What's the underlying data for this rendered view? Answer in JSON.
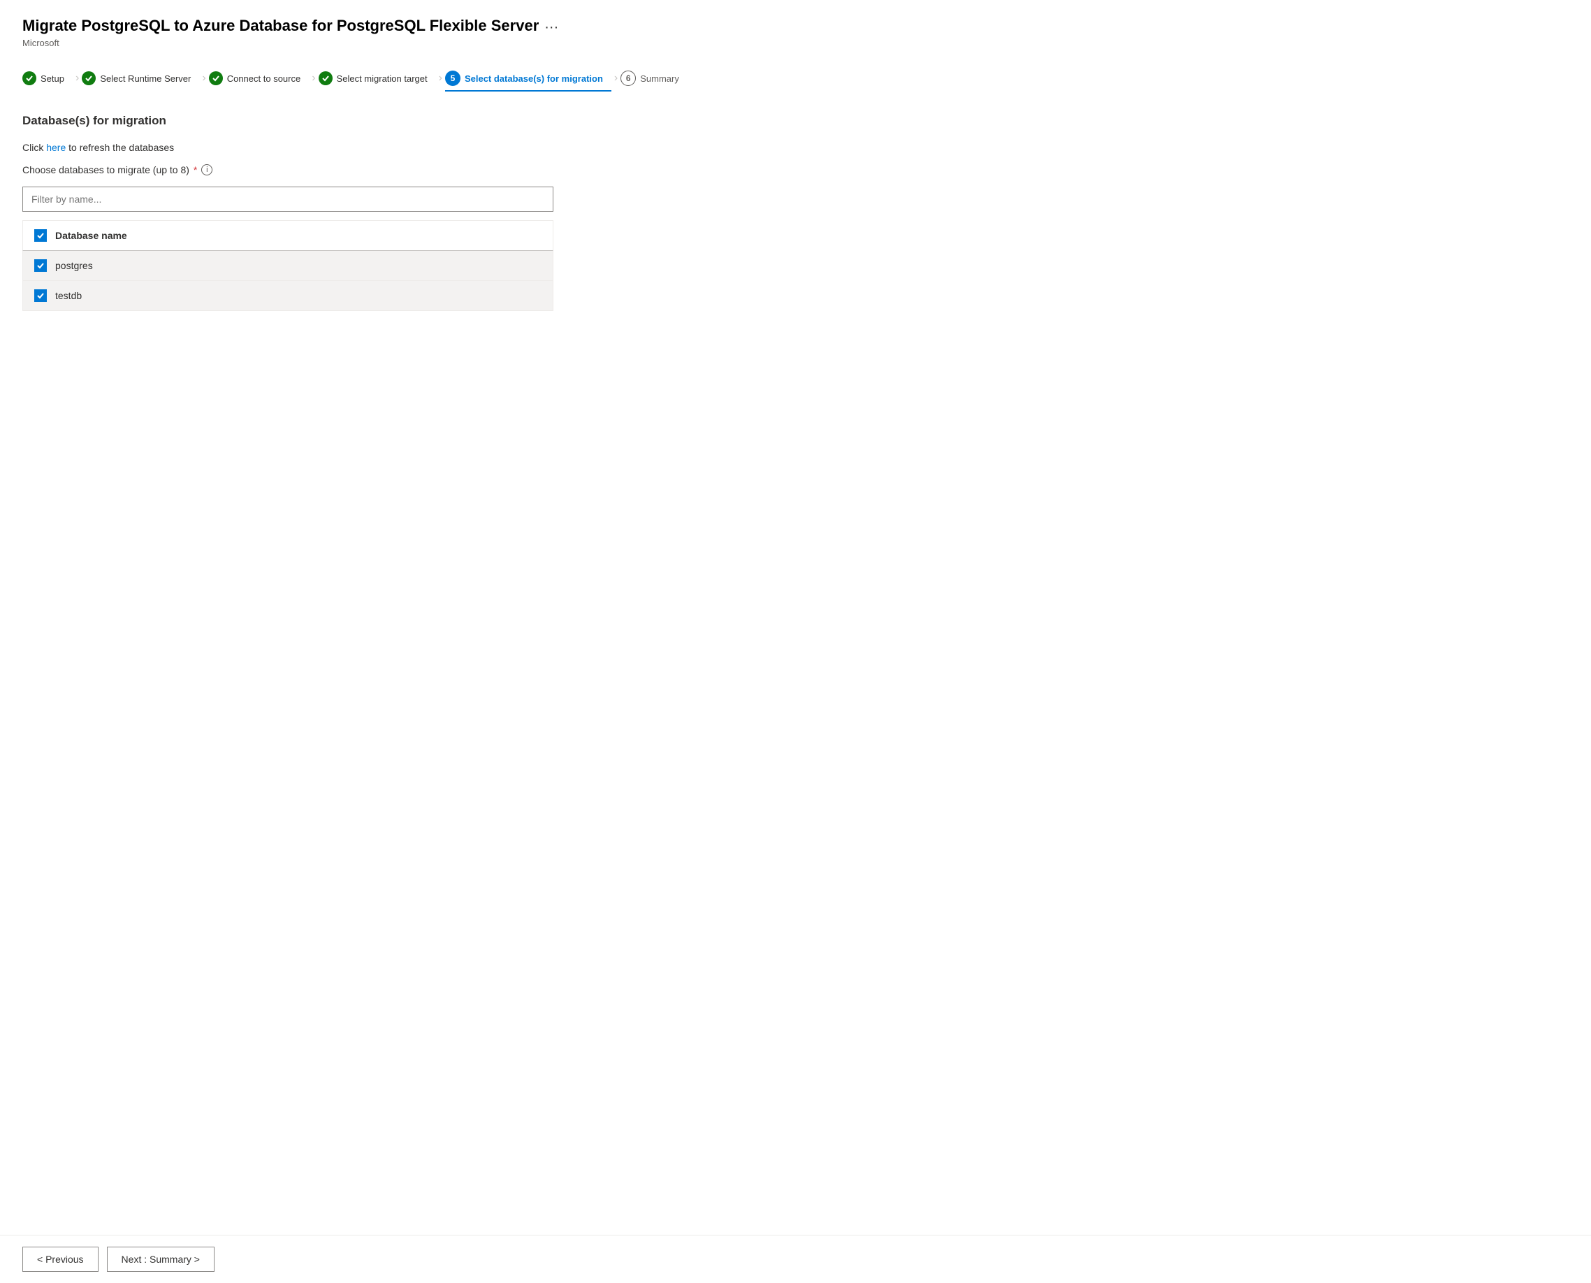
{
  "header": {
    "title": "Migrate PostgreSQL to Azure Database for PostgreSQL Flexible Server",
    "subtitle": "Microsoft",
    "more_label": "···"
  },
  "wizard": {
    "steps": [
      {
        "id": "setup",
        "label": "Setup",
        "state": "completed",
        "number": 1
      },
      {
        "id": "select-runtime-server",
        "label": "Select Runtime Server",
        "state": "completed",
        "number": 2
      },
      {
        "id": "connect-to-source",
        "label": "Connect to source",
        "state": "completed",
        "number": 3
      },
      {
        "id": "select-migration-target",
        "label": "Select migration target",
        "state": "completed",
        "number": 4
      },
      {
        "id": "select-databases",
        "label": "Select database(s) for migration",
        "state": "active",
        "number": 5
      },
      {
        "id": "summary",
        "label": "Summary",
        "state": "upcoming",
        "number": 6
      }
    ]
  },
  "section": {
    "title": "Database(s) for migration",
    "refresh_text_before": "Click ",
    "refresh_link": "here",
    "refresh_text_after": " to refresh the databases",
    "choose_label": "Choose databases to migrate (up to 8)",
    "filter_placeholder": "Filter by name...",
    "db_column_header": "Database name",
    "databases": [
      {
        "name": "postgres",
        "checked": true
      },
      {
        "name": "testdb",
        "checked": true
      }
    ]
  },
  "footer": {
    "previous_label": "< Previous",
    "next_label": "Next : Summary >"
  }
}
